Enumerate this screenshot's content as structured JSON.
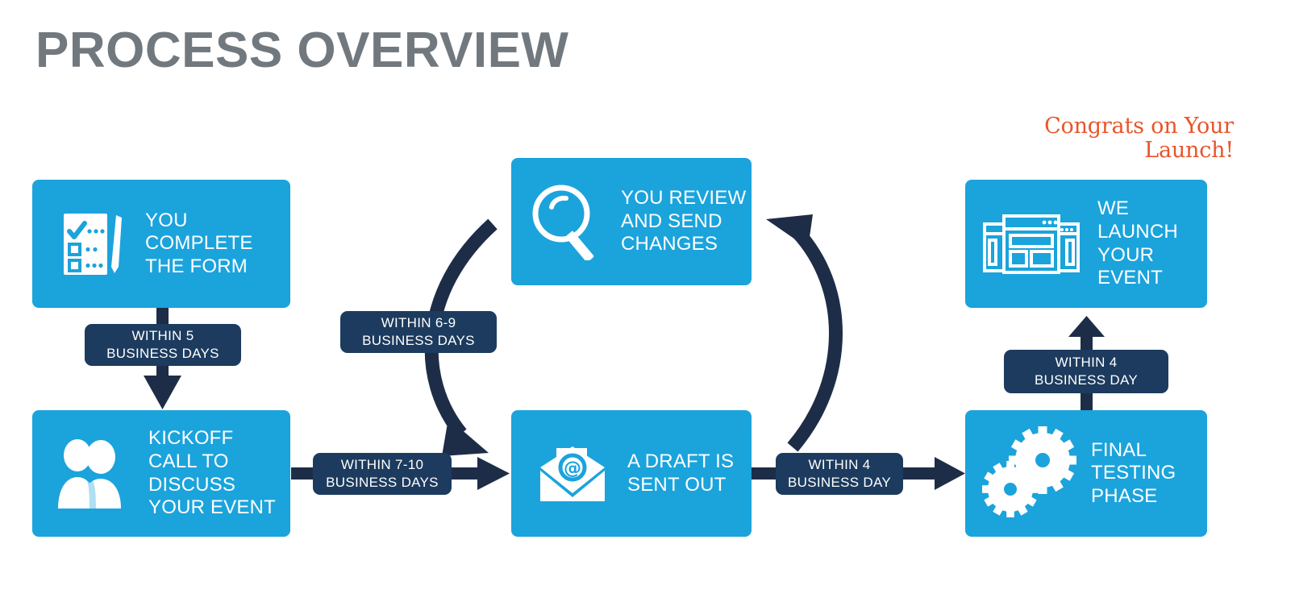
{
  "title": "PROCESS OVERVIEW",
  "congrats": "Congrats on\nYour Launch!",
  "colors": {
    "card_blue": "#1BA3DC",
    "pill_navy": "#1C3B5E",
    "arrow_navy": "#1E2D47",
    "title_gray": "#71797F",
    "congrats_orange": "#E8552A",
    "text_white": "#FFFFFF",
    "background": "#FFFFFF"
  },
  "steps": [
    {
      "id": "complete-form",
      "label": "YOU\nCOMPLETE\nTHE FORM",
      "icon": "clipboard-pen-icon"
    },
    {
      "id": "kickoff-call",
      "label": "KICKOFF\nCALL TO\nDISCUSS\nYOUR EVENT",
      "icon": "two-people-icon"
    },
    {
      "id": "review-changes",
      "label": "YOU REVIEW\nAND SEND\nCHANGES",
      "icon": "magnifying-glass-icon"
    },
    {
      "id": "draft-sent",
      "label": "A DRAFT IS\nSENT OUT",
      "icon": "email-envelope-icon"
    },
    {
      "id": "final-testing",
      "label": "FINAL\nTESTING\nPHASE",
      "icon": "gears-icon"
    },
    {
      "id": "launch-event",
      "label": "WE\nLAUNCH\nYOUR\nEVENT",
      "icon": "browser-windows-icon"
    }
  ],
  "durations": [
    {
      "id": "form-to-kickoff",
      "label": "WITHIN 5\nBUSINESS DAYS"
    },
    {
      "id": "kickoff-to-draft",
      "label": "WITHIN 7-10\nBUSINESS DAYS"
    },
    {
      "id": "review-loop",
      "label": "WITHIN 6-9\nBUSINESS DAYS"
    },
    {
      "id": "draft-to-testing",
      "label": "WITHIN 4\nBUSINESS DAY"
    },
    {
      "id": "testing-to-launch",
      "label": "WITHIN 4\nBUSINESS DAY"
    }
  ]
}
